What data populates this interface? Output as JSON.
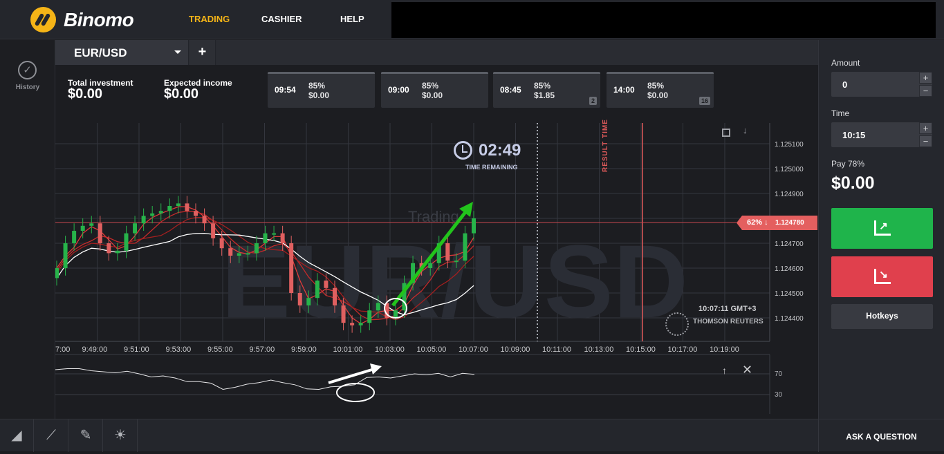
{
  "app": {
    "brand": "Binomo"
  },
  "nav": {
    "trading": "TRADING",
    "cashier": "CASHIER",
    "help": "HELP"
  },
  "sidebar": {
    "history_label": "History"
  },
  "tabs": {
    "asset": "EUR/USD",
    "add": "+"
  },
  "investment": {
    "total_label": "Total investment",
    "total_value": "$0.00",
    "expected_label": "Expected income",
    "expected_value": "$0.00"
  },
  "deals": [
    {
      "time": "09:54",
      "pct": "85%",
      "amount": "$0.00",
      "count": ""
    },
    {
      "time": "09:00",
      "pct": "85%",
      "amount": "$0.00",
      "count": ""
    },
    {
      "time": "08:45",
      "pct": "85%",
      "amount": "$1.85",
      "count": "2"
    },
    {
      "time": "14:00",
      "pct": "85%",
      "amount": "$0.00",
      "count": "16"
    }
  ],
  "timer": {
    "value": "02:49",
    "label": "TIME REMAINING"
  },
  "chart": {
    "watermark": "EUR/USD",
    "watermark_small": "Trading",
    "result_label": "RESULT TIME",
    "server_time": "10:07:11 GMT+3",
    "provider": "THOMSON REUTERS",
    "current_price": {
      "pct": "62% ↓",
      "value": "1.124780"
    }
  },
  "chart_data": {
    "type": "candlestick",
    "y_ticks": [
      "1.125100",
      "1.125000",
      "1.124900",
      "1.124800",
      "1.124700",
      "1.124600",
      "1.124500",
      "1.124400"
    ],
    "x_ticks": [
      "7:00",
      "9:49:00",
      "9:51:00",
      "9:53:00",
      "9:55:00",
      "9:57:00",
      "9:59:00",
      "10:01:00",
      "10:03:00",
      "10:05:00",
      "10:07:00",
      "10:09:00",
      "10:11:00",
      "10:13:00",
      "10:15:00",
      "10:17:00",
      "10:19:00"
    ],
    "ylim": [
      1.12434,
      1.12515
    ],
    "close": [
      1.1246,
      1.1247,
      1.12475,
      1.12477,
      1.12478,
      1.1247,
      1.12466,
      1.12467,
      1.12474,
      1.12478,
      1.12481,
      1.12482,
      1.12483,
      1.12485,
      1.12486,
      1.12483,
      1.12481,
      1.12478,
      1.12472,
      1.12468,
      1.12465,
      1.12466,
      1.12466,
      1.1247,
      1.12474,
      1.12474,
      1.1247,
      1.1245,
      1.12445,
      1.12448,
      1.12455,
      1.12452,
      1.12445,
      1.12438,
      1.12437,
      1.12438,
      1.12443,
      1.12446,
      1.1244,
      1.12443,
      1.12454,
      1.12462,
      1.1246,
      1.12462,
      1.1247,
      1.12463,
      1.12463,
      1.12474,
      1.1248
    ],
    "indicator_levels": [
      "70",
      "30"
    ],
    "indicator_values": [
      78,
      80,
      80,
      76,
      74,
      72,
      75,
      70,
      64,
      66,
      62,
      55,
      55,
      52,
      40,
      44,
      50,
      53,
      58,
      53,
      49,
      41,
      40,
      45,
      46,
      49,
      63,
      64,
      62,
      66,
      70,
      68,
      71,
      64,
      71,
      69
    ]
  },
  "panel": {
    "amount_label": "Amount",
    "amount_value": "0",
    "time_label": "Time",
    "time_value": "10:15",
    "pay_label": "Pay 78%",
    "pay_value": "$0.00",
    "hotkeys": "Hotkeys",
    "plus": "+",
    "minus": "−"
  },
  "bottom": {
    "ask": "ASK A QUESTION"
  },
  "colors": {
    "accent": "#f5b417",
    "up": "#1fb44b",
    "down": "#e0404d",
    "price_line": "#e45f5f"
  }
}
